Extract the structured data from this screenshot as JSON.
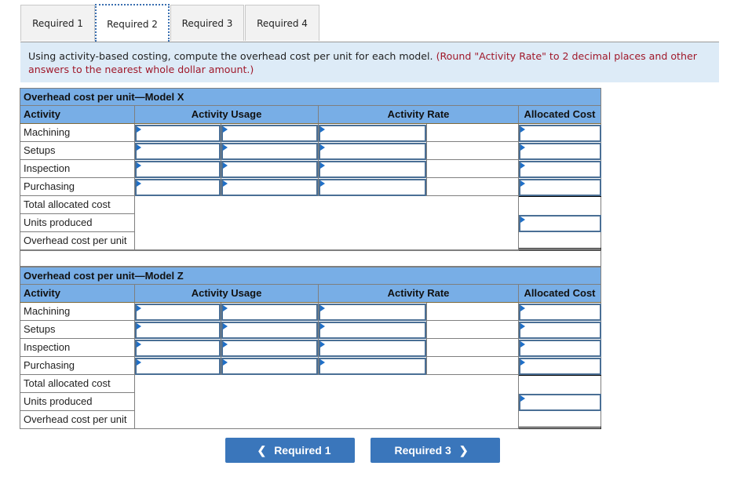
{
  "tabs": [
    {
      "label": "Required 1",
      "active": false
    },
    {
      "label": "Required 2",
      "active": true
    },
    {
      "label": "Required 3",
      "active": false
    },
    {
      "label": "Required 4",
      "active": false
    }
  ],
  "instruction": {
    "text": "Using activity-based costing, compute the overhead cost per unit for each model.",
    "note": "(Round \"Activity Rate\" to 2 decimal places and other answers to the nearest whole dollar amount.)"
  },
  "tables": [
    {
      "title": "Overhead cost per unit—Model X",
      "columns": [
        "Activity",
        "Activity Usage",
        "Activity Rate",
        "Allocated Cost"
      ],
      "activities": [
        "Machining",
        "Setups",
        "Inspection",
        "Purchasing"
      ],
      "summary_rows": [
        "Total allocated cost",
        "Units produced",
        "Overhead cost per unit"
      ]
    },
    {
      "title": "Overhead cost per unit—Model Z",
      "columns": [
        "Activity",
        "Activity Usage",
        "Activity Rate",
        "Allocated Cost"
      ],
      "activities": [
        "Machining",
        "Setups",
        "Inspection",
        "Purchasing"
      ],
      "summary_rows": [
        "Total allocated cost",
        "Units produced",
        "Overhead cost per unit"
      ]
    }
  ],
  "nav": {
    "prev_label": "Required 1",
    "next_label": "Required 3",
    "prev_icon": "chevron-left-icon",
    "next_icon": "chevron-right-icon"
  },
  "colors": {
    "header_blue": "#78aee6",
    "instruction_bg": "#ddebf7",
    "note_red": "#a0182a",
    "button_blue": "#3a76bb"
  }
}
